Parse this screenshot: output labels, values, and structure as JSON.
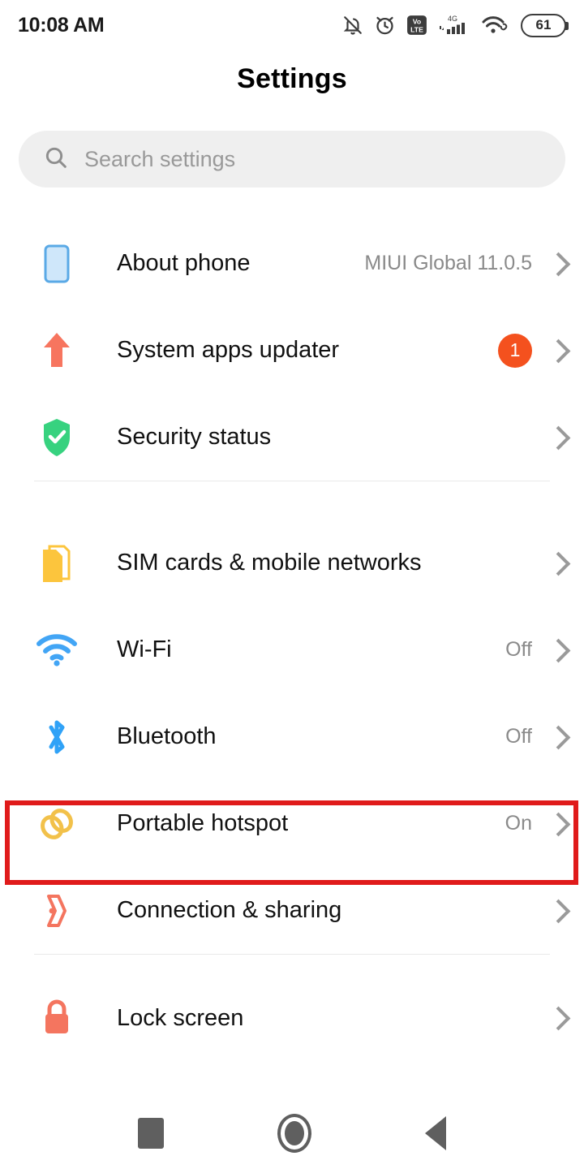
{
  "status_bar": {
    "time": "10:08 AM",
    "icons": [
      {
        "name": "notification-silent-icon",
        "label": "silent"
      },
      {
        "name": "alarm-icon",
        "label": "alarm"
      },
      {
        "name": "volte-icon",
        "label": "VoLTE"
      },
      {
        "name": "signal-4g-icon",
        "label": "4G"
      },
      {
        "name": "wifi-hotspot-icon",
        "label": "wifi"
      }
    ],
    "battery_level": "61"
  },
  "header": {
    "title": "Settings"
  },
  "search": {
    "placeholder": "Search settings",
    "value": "",
    "icon": "search-icon"
  },
  "groups": [
    {
      "id": "group-device",
      "items": [
        {
          "id": "about-phone",
          "label": "About phone",
          "value": "MIUI Global 11.0.5",
          "badge": "",
          "icon": "phone-outline-icon",
          "icon_color": "#57b0f0"
        },
        {
          "id": "system-apps-updater",
          "label": "System apps updater",
          "value": "",
          "badge": "1",
          "icon": "arrow-up-icon",
          "icon_color": "#f7755f"
        },
        {
          "id": "security-status",
          "label": "Security status",
          "value": "",
          "badge": "",
          "icon": "shield-check-icon",
          "icon_color": "#37d27f"
        }
      ]
    },
    {
      "id": "group-connectivity",
      "items": [
        {
          "id": "sim-cards-mobile-networks",
          "label": "SIM cards & mobile networks",
          "value": "",
          "badge": "",
          "icon": "sim-card-icon",
          "icon_color": "#fcc53d"
        },
        {
          "id": "wifi",
          "label": "Wi-Fi",
          "value": "Off",
          "badge": "",
          "icon": "wifi-icon",
          "icon_color": "#42a5f5"
        },
        {
          "id": "bluetooth",
          "label": "Bluetooth",
          "value": "Off",
          "badge": "",
          "icon": "bluetooth-icon",
          "icon_color": "#30a2f7"
        },
        {
          "id": "portable-hotspot",
          "label": "Portable hotspot",
          "value": "On",
          "badge": "",
          "icon": "hotspot-rings-icon",
          "icon_color": "#f2c14a"
        },
        {
          "id": "connection-sharing",
          "label": "Connection & sharing",
          "value": "",
          "badge": "",
          "icon": "connection-share-icon",
          "icon_color": "#f4755f"
        }
      ]
    },
    {
      "id": "group-personal",
      "items": [
        {
          "id": "lock-screen",
          "label": "Lock screen",
          "value": "",
          "badge": "",
          "icon": "lock-icon",
          "icon_color": "#f4755f"
        }
      ]
    }
  ],
  "highlight": {
    "target": "portable-hotspot",
    "color": "#e01b1b"
  },
  "nav_bar": {
    "recents_label": "Recents",
    "home_label": "Home",
    "back_label": "Back"
  }
}
